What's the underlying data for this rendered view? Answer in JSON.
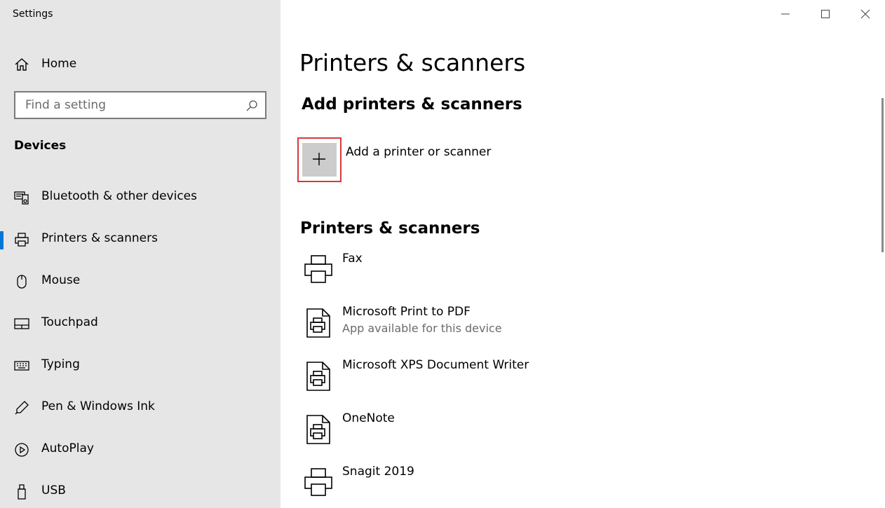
{
  "window": {
    "app_title": "Settings",
    "controls": {
      "minimize_icon": "minimize-icon",
      "maximize_icon": "maximize-icon",
      "close_icon": "close-icon"
    }
  },
  "sidebar": {
    "home_label": "Home",
    "search_placeholder": "Find a setting",
    "section_heading": "Devices",
    "items": [
      {
        "label": "Bluetooth & other devices",
        "icon": "bluetooth-devices-icon",
        "selected": false
      },
      {
        "label": "Printers & scanners",
        "icon": "printer-icon",
        "selected": true
      },
      {
        "label": "Mouse",
        "icon": "mouse-icon",
        "selected": false
      },
      {
        "label": "Touchpad",
        "icon": "touchpad-icon",
        "selected": false
      },
      {
        "label": "Typing",
        "icon": "keyboard-icon",
        "selected": false
      },
      {
        "label": "Pen & Windows Ink",
        "icon": "pen-icon",
        "selected": false
      },
      {
        "label": "AutoPlay",
        "icon": "autoplay-icon",
        "selected": false
      },
      {
        "label": "USB",
        "icon": "usb-icon",
        "selected": false
      }
    ]
  },
  "main": {
    "page_title": "Printers & scanners",
    "add_heading": "Add printers & scanners",
    "add_button_label": "Add a printer or scanner",
    "list_heading": "Printers & scanners",
    "devices": [
      {
        "name": "Fax",
        "sub": "",
        "icon": "printer-icon"
      },
      {
        "name": "Microsoft Print to PDF",
        "sub": "App available for this device",
        "icon": "print-to-file-icon"
      },
      {
        "name": "Microsoft XPS Document Writer",
        "sub": "",
        "icon": "print-to-file-icon"
      },
      {
        "name": "OneNote",
        "sub": "",
        "icon": "print-to-file-icon"
      },
      {
        "name": "Snagit 2019",
        "sub": "",
        "icon": "printer-icon"
      }
    ]
  },
  "colors": {
    "sidebar_bg": "#e6e6e6",
    "accent": "#0078d7",
    "highlight_border": "#d63a3a",
    "add_tile_bg": "#cccccc"
  }
}
